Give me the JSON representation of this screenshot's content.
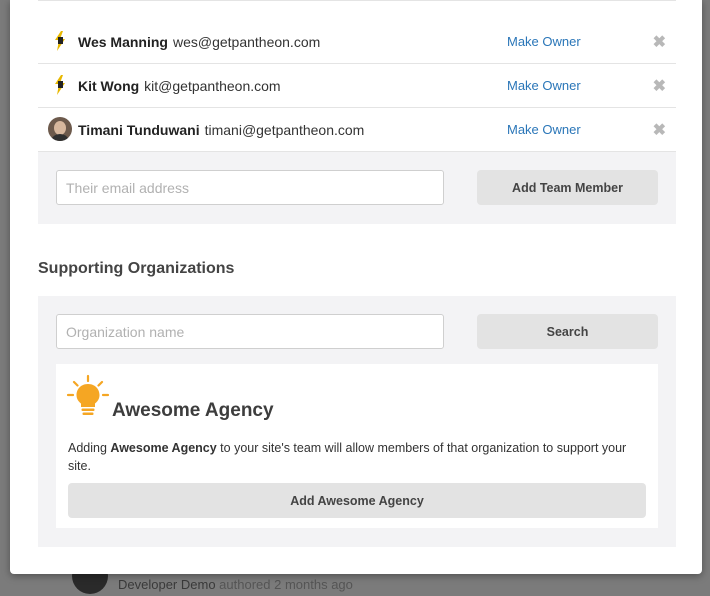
{
  "underlying": {
    "author_name": "Developer Demo",
    "author_action": "authored 2 months ago"
  },
  "team": {
    "members": [
      {
        "name": "Wes Manning",
        "email": "wes@getpantheon.com",
        "avatar": "pantheon-bolt-icon",
        "action": "Make Owner"
      },
      {
        "name": "Kit Wong",
        "email": "kit@getpantheon.com",
        "avatar": "pantheon-bolt-icon",
        "action": "Make Owner"
      },
      {
        "name": "Timani Tunduwani",
        "email": "timani@getpantheon.com",
        "avatar": "user-photo",
        "action": "Make Owner"
      }
    ],
    "remove_symbol": "✖",
    "email_placeholder": "Their email address",
    "add_button": "Add Team Member"
  },
  "orgs": {
    "title": "Supporting Organizations",
    "search_placeholder": "Organization name",
    "search_button": "Search",
    "result": {
      "icon": "lightbulb-icon",
      "name": "Awesome Agency",
      "desc_prefix": "Adding ",
      "desc_name": "Awesome Agency",
      "desc_suffix": " to your site's team will allow members of that organization to support your site.",
      "add_button": "Add Awesome Agency"
    }
  },
  "colors": {
    "link": "#2a76b8",
    "panel": "#f3f3f5",
    "button": "#e3e3e3",
    "bulb": "#f5a623"
  }
}
